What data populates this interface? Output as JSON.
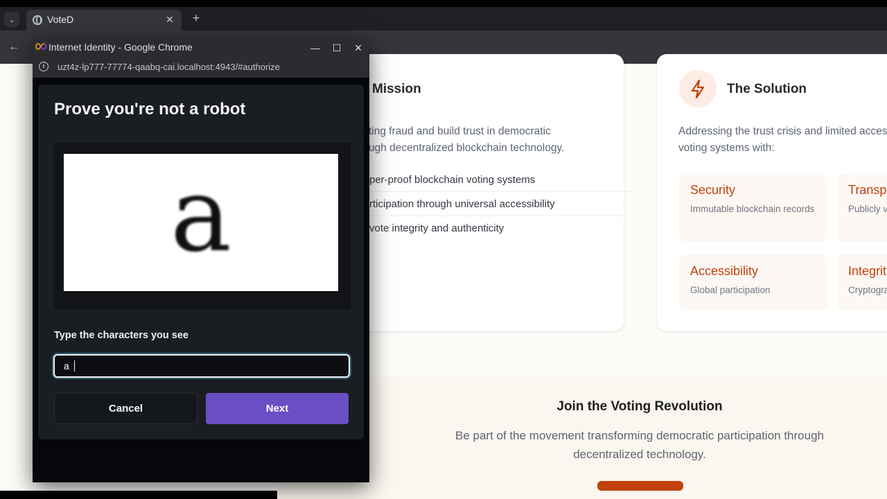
{
  "browser": {
    "tab": {
      "title": "VoteD"
    },
    "new_tab_label": "+",
    "tab_list_label": "⌄",
    "tab_close_label": "✕",
    "back_label": "←"
  },
  "popup": {
    "window_title": "Internet Identity - Google Chrome",
    "url": "uzt4z-lp777-77774-qaabq-cai.localhost:4943/#authorize",
    "minimize_label": "—",
    "maximize_label": "☐",
    "close_label": "✕",
    "heading": "Prove you're not a robot",
    "captcha_char": "a",
    "input_label": "Type the characters you see",
    "input_value": "a",
    "cancel_label": "Cancel",
    "next_label": "Next",
    "accent_color": "#6a4fc4"
  },
  "page": {
    "mission": {
      "heading": "Mission",
      "text_lines": [
        "ting fraud and build trust in democratic",
        "ugh decentralized blockchain technology."
      ],
      "items": [
        "per-proof blockchain voting systems",
        "rticipation through universal accessibility",
        "vote integrity and authenticity"
      ]
    },
    "solution": {
      "heading": "The Solution",
      "icon": "lightning-icon",
      "text_lines": [
        "Addressing the trust crisis and limited acces",
        "voting systems with:"
      ],
      "features": [
        {
          "title": "Security",
          "desc": "Immutable blockchain records"
        },
        {
          "title": "Transpa",
          "desc": "Publicly v"
        },
        {
          "title": "Accessibility",
          "desc": "Global participation"
        },
        {
          "title": "Integrit",
          "desc": "Cryptogra"
        }
      ]
    },
    "cta": {
      "title": "Join the Voting Revolution",
      "lines": [
        "Be part of the movement transforming democratic participation through",
        "decentralized technology."
      ]
    },
    "brand_color": "#c2410c"
  }
}
